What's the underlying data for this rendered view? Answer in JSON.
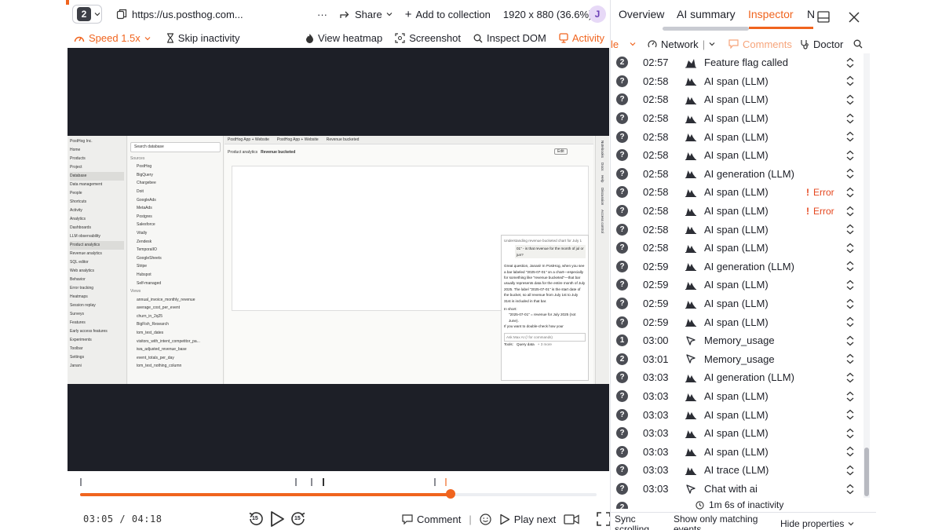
{
  "browser": {
    "tab_count": "2",
    "url": "https://us.posthog.com...",
    "more_label": "···",
    "share_label": "Share",
    "add_collection_label": "Add to collection",
    "resolution": "1920 x 880 (36.6%)",
    "avatar_initial": "J"
  },
  "toolbar": {
    "speed_label": "Speed 1.5x",
    "skip_inactivity_label": "Skip inactivity",
    "heatmap_label": "View heatmap",
    "screenshot_label": "Screenshot",
    "inspect_dom_label": "Inspect DOM",
    "activity_label": "Activity"
  },
  "recording": {
    "sidebar_items": [
      "PostHog Inc.",
      "Home",
      "Products",
      "Project",
      "Database",
      "Data management",
      "People",
      "Shortcuts",
      "Activity",
      "Analytics",
      "Dashboards",
      "LLM observability",
      "Product analytics",
      "Revenue analytics",
      "SQL editor",
      "Web analytics",
      "Behavior",
      "Error tracking",
      "Heatmaps",
      "Session replay",
      "Surveys",
      "Features",
      "Early access features",
      "Experiments",
      "Toolbar",
      "Settings",
      "Janani"
    ],
    "db_search": "Search database",
    "db_sources_title": "Sources",
    "db_sources": [
      "PostHog",
      "BigQuery",
      "Chargebee",
      "Doit",
      "GoogleAds",
      "MetaAds",
      "Postgres",
      "Salesforce",
      "Vitally",
      "Zendesk",
      "TemporalIO",
      "GoogleSheets",
      "Stripe",
      "Hubspot",
      "Self-managed"
    ],
    "db_views_title": "Views",
    "db_views": [
      "annual_invoice_monthly_revenue",
      "average_cost_per_event",
      "churn_in_2q25",
      "BigFish_Research",
      "tom_test_dates",
      "visitors_with_intent_competitor_pa...",
      "iwa_adjusted_revenue_base",
      "event_totals_per_day",
      "tom_test_nothing_column"
    ],
    "tab_a": "PostHog App + Website",
    "tab_b": "PostHog App + Website",
    "tab_c": "Revenue bucketed",
    "breadcrumb": "Product analytics",
    "breadcrumb_current": "Revenue bucketed",
    "edit_label": "Edit",
    "chat_title": "Understanding revenue bucketed chart for July 1",
    "chat_quote": "01\" - is that revenue for the month of jul or jun?",
    "chat_p1": "Great question, Janani! In PostHog, when you see a bar labeled \"2025-07-01\" on a chart—especially for something like \"revenue bucketed\"—that bar usually represents data for the entire month of July 2025. The label \"2025-07-01\" is the start date of the bucket, so all revenue from July 1st to July 31st is included in that bar.",
    "chat_short": "In short:",
    "chat_bullet": "\"2025-07-01\" = revenue for July 2025 (not June).",
    "chat_p2": "If you want to double-check how your",
    "chat_input": "Ask Max AI (/ for commands)",
    "chat_tools": "Tools:",
    "chat_tool": "Query data",
    "chat_more": "+ 3 more",
    "rail_items": [
      "Notebooks",
      "Docs",
      "Help",
      "Discussion",
      "Access control"
    ]
  },
  "timeline": {
    "current_time": "03:05",
    "total_time": "04:18",
    "skip_back": "15",
    "skip_fwd": "15",
    "comment_label": "Comment",
    "play_next_label": "Play next"
  },
  "inspector": {
    "tabs": [
      "Overview",
      "AI summary",
      "Inspector",
      "N"
    ],
    "filters": {
      "partial": "le",
      "network_label": "Network",
      "comments_label": "Comments",
      "doctor_label": "Doctor"
    },
    "events": [
      {
        "n": "2",
        "time": "02:57",
        "icon": "flag-icon",
        "label": "Feature flag called",
        "error": ""
      },
      {
        "n": "?",
        "time": "02:58",
        "icon": "ai-icon",
        "label": "AI span (LLM)",
        "error": ""
      },
      {
        "n": "?",
        "time": "02:58",
        "icon": "ai-icon",
        "label": "AI span (LLM)",
        "error": ""
      },
      {
        "n": "?",
        "time": "02:58",
        "icon": "ai-icon",
        "label": "AI span (LLM)",
        "error": ""
      },
      {
        "n": "?",
        "time": "02:58",
        "icon": "ai-icon",
        "label": "AI span (LLM)",
        "error": ""
      },
      {
        "n": "?",
        "time": "02:58",
        "icon": "ai-icon",
        "label": "AI span (LLM)",
        "error": ""
      },
      {
        "n": "?",
        "time": "02:58",
        "icon": "ai-icon",
        "label": "AI generation (LLM)",
        "error": ""
      },
      {
        "n": "?",
        "time": "02:58",
        "icon": "ai-icon",
        "label": "AI span (LLM)",
        "error": "Error"
      },
      {
        "n": "?",
        "time": "02:58",
        "icon": "ai-icon",
        "label": "AI span (LLM)",
        "error": "Error"
      },
      {
        "n": "?",
        "time": "02:58",
        "icon": "ai-icon",
        "label": "AI span (LLM)",
        "error": ""
      },
      {
        "n": "?",
        "time": "02:58",
        "icon": "ai-icon",
        "label": "AI span (LLM)",
        "error": ""
      },
      {
        "n": "?",
        "time": "02:59",
        "icon": "ai-icon",
        "label": "AI generation (LLM)",
        "error": ""
      },
      {
        "n": "?",
        "time": "02:59",
        "icon": "ai-icon",
        "label": "AI span (LLM)",
        "error": ""
      },
      {
        "n": "?",
        "time": "02:59",
        "icon": "ai-icon",
        "label": "AI span (LLM)",
        "error": ""
      },
      {
        "n": "?",
        "time": "02:59",
        "icon": "ai-icon",
        "label": "AI span (LLM)",
        "error": ""
      },
      {
        "n": "1",
        "time": "03:00",
        "icon": "cursor-icon",
        "label": "Memory_usage",
        "error": ""
      },
      {
        "n": "2",
        "time": "03:01",
        "icon": "cursor-icon",
        "label": "Memory_usage",
        "error": ""
      },
      {
        "n": "?",
        "time": "03:03",
        "icon": "ai-icon",
        "label": "AI generation (LLM)",
        "error": ""
      },
      {
        "n": "?",
        "time": "03:03",
        "icon": "ai-icon",
        "label": "AI span (LLM)",
        "error": ""
      },
      {
        "n": "?",
        "time": "03:03",
        "icon": "ai-icon",
        "label": "AI span (LLM)",
        "error": ""
      },
      {
        "n": "?",
        "time": "03:03",
        "icon": "ai-icon",
        "label": "AI span (LLM)",
        "error": ""
      },
      {
        "n": "?",
        "time": "03:03",
        "icon": "ai-icon",
        "label": "AI span (LLM)",
        "error": ""
      },
      {
        "n": "?",
        "time": "03:03",
        "icon": "ai-icon",
        "label": "AI trace (LLM)",
        "error": ""
      },
      {
        "n": "?",
        "time": "03:03",
        "icon": "cursor-icon",
        "label": "Chat with ai",
        "error": ""
      },
      {
        "n": "2",
        "time": "",
        "icon": "",
        "label": "",
        "error": ""
      }
    ],
    "inactivity_label": "1m 6s of inactivity",
    "sync_scrolling_label": "Sync scrolling",
    "show_matching_label": "Show only matching events",
    "hide_properties_label": "Hide properties"
  },
  "colors": {
    "accent": "#f0641e",
    "error": "#e5471f",
    "player_bg": "#1d1f27"
  }
}
